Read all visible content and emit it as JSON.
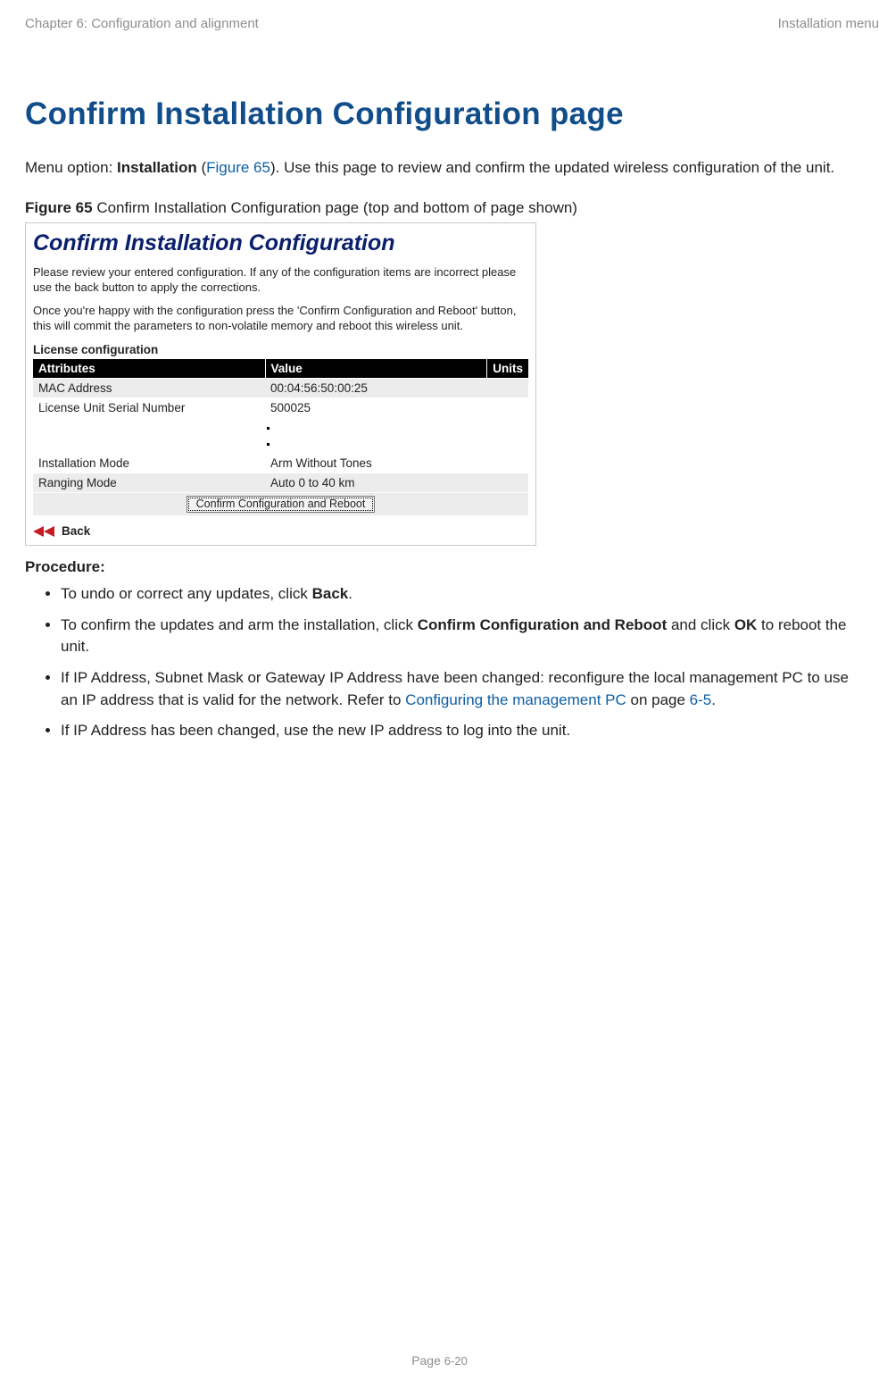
{
  "header": {
    "left": "Chapter 6:  Configuration and alignment",
    "right": "Installation menu"
  },
  "title": "Confirm Installation Configuration page",
  "intro": {
    "prefix": "Menu option: ",
    "bold": "Installation",
    "mid": " (",
    "link": "Figure 65",
    "suffix": "). Use this page to review and confirm the updated wireless configuration of the unit."
  },
  "figure": {
    "label": "Figure 65",
    "caption": "  Confirm Installation Configuration page (top and bottom of page shown)",
    "panel_title": "Confirm Installation Configuration",
    "p1": "Please review your entered configuration. If any of the configuration items are incorrect please use the back button to apply the corrections.",
    "p2": "Once you're happy with the configuration press the 'Confirm Configuration and Reboot' button, this will commit the parameters to non-volatile memory and reboot this wireless unit.",
    "section": "License configuration",
    "headers": {
      "attr": "Attributes",
      "val": "Value",
      "unit": "Units"
    },
    "rows_top": [
      {
        "attr": "MAC Address",
        "val": "00:04:56:50:00:25",
        "unit": ""
      },
      {
        "attr": "License Unit Serial Number",
        "val": "500025",
        "unit": ""
      }
    ],
    "rows_bottom": [
      {
        "attr": "Installation Mode",
        "val": "Arm Without Tones",
        "unit": ""
      },
      {
        "attr": "Ranging Mode",
        "val": "Auto 0 to 40 km",
        "unit": ""
      }
    ],
    "button": "Confirm Configuration and Reboot",
    "back": "Back"
  },
  "procedure": {
    "heading": "Procedure:",
    "items": [
      {
        "pre": "To undo or correct any updates, click ",
        "b1": "Back",
        "post": "."
      },
      {
        "pre": "To confirm the updates and arm the installation, click ",
        "b1": "Confirm Configuration and Reboot",
        "mid": " and click ",
        "b2": "OK",
        "post": " to reboot the unit."
      },
      {
        "pre": "If IP Address, Subnet Mask or Gateway IP Address have been changed: reconfigure the local management PC to use an IP address that is valid for the network. Refer to ",
        "link1": "Configuring the management PC",
        "mid": " on page ",
        "link2": "6-5",
        "post": "."
      },
      {
        "pre": "If IP Address has been changed, use the new IP address to log into the unit."
      }
    ]
  },
  "footer": {
    "label": "Page ",
    "num": "6-20"
  }
}
